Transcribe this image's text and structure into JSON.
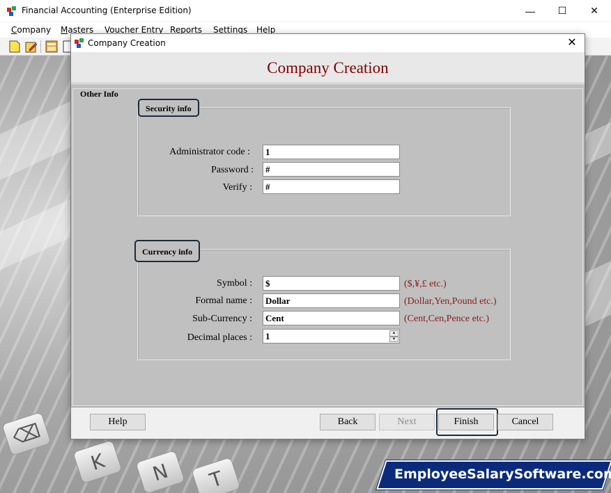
{
  "app": {
    "title": "Financial Accounting (Enterprise Edition)",
    "minimize": "—",
    "maximize": "☐",
    "close": "✕"
  },
  "menu": [
    "Company",
    "Masters",
    "Voucher Entry",
    "Reports",
    "Settings",
    "Help"
  ],
  "dialog": {
    "title": "Company Creation",
    "close": "✕",
    "heading": "Company Creation",
    "section_label": "Other Info",
    "security": {
      "label": "Security info",
      "admin_code_label": "Administrator code :",
      "admin_code_value": "1",
      "password_label": "Password :",
      "password_value": "#",
      "verify_label": "Verify :",
      "verify_value": "#"
    },
    "currency": {
      "label": "Currency info",
      "symbol_label": "Symbol :",
      "symbol_value": "$",
      "symbol_hint": "($,¥,£ etc.)",
      "formal_label": "Formal name :",
      "formal_value": "Dollar",
      "formal_hint": "(Dollar,Yen,Pound etc.)",
      "sub_label": "Sub-Currency :",
      "sub_value": "Cent",
      "sub_hint": "(Cent,Cen,Pence etc.)",
      "decimal_label": "Decimal places :",
      "decimal_value": "1"
    },
    "buttons": {
      "help": "Help",
      "back": "Back",
      "next": "Next",
      "finish": "Finish",
      "cancel": "Cancel"
    }
  },
  "watermark": "EmployeeSalarySoftware.com",
  "colors": {
    "heading": "#800000",
    "hint": "#8b1a1a",
    "watermark_bg": "#0b2b7a"
  }
}
